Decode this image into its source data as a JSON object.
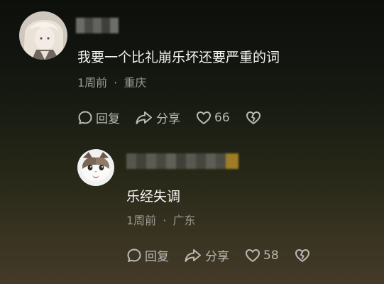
{
  "comments": [
    {
      "text": "我要一个比礼崩乐坏还要严重的词",
      "time": "1周前",
      "separator": "·",
      "location": "重庆",
      "reply_label": "回复",
      "share_label": "分享",
      "likes": "66",
      "avatar_icon": "anime-avatar-icon"
    },
    {
      "text": "乐经失调",
      "time": "1周前",
      "separator": "·",
      "location": "广东",
      "reply_label": "回复",
      "share_label": "分享",
      "likes": "58",
      "avatar_icon": "cat-avatar-icon"
    }
  ],
  "colors": {
    "text": "#f5f5f5",
    "meta": "#9a9a94",
    "icon": "#b9b9b4",
    "name_accent": "#c89a2a"
  }
}
